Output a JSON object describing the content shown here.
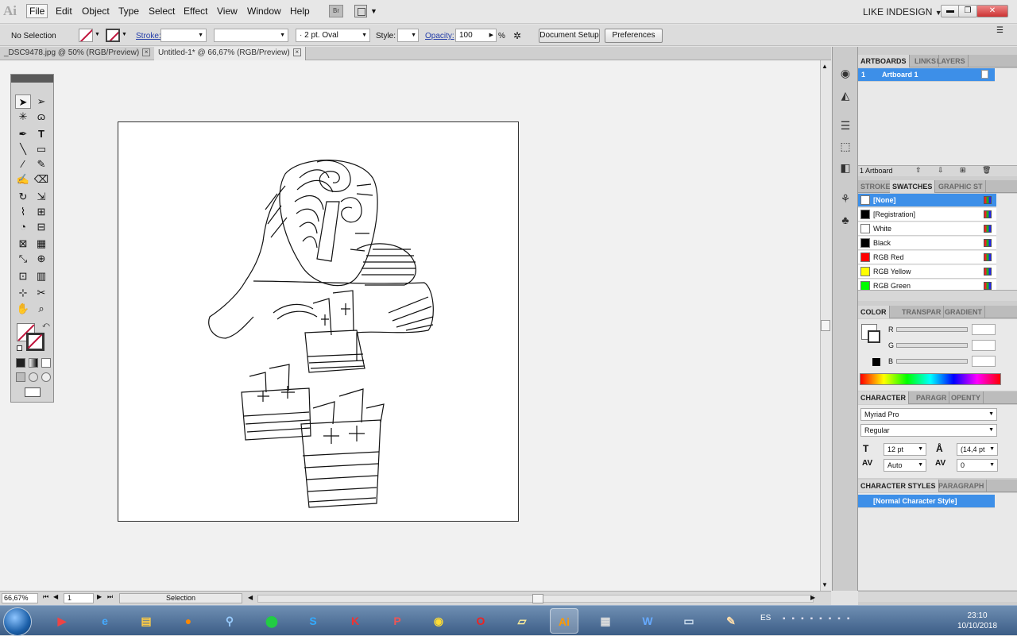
{
  "app": {
    "logo": "Ai",
    "workspace": "LIKE INDESIGN",
    "bridge_label": "Br"
  },
  "menu": [
    "File",
    "Edit",
    "Object",
    "Type",
    "Select",
    "Effect",
    "View",
    "Window",
    "Help"
  ],
  "control": {
    "selection": "No Selection",
    "stroke_label": "Stroke:",
    "brush": "2 pt. Oval",
    "style_label": "Style:",
    "opacity_label": "Opacity:",
    "opacity_value": "100",
    "opacity_unit": "%",
    "document_setup": "Document Setup",
    "preferences": "Preferences"
  },
  "tabs": [
    {
      "label": "_DSC9478.jpg @ 50% (RGB/Preview)"
    },
    {
      "label": "Untitled-1* @ 66,67% (RGB/Preview)"
    }
  ],
  "status": {
    "zoom": "66,67%",
    "artboard": "1",
    "mode": "Selection"
  },
  "panels": {
    "artboards": {
      "tabs": [
        "ARTBOARDS",
        "LINKS",
        "LAYERS"
      ],
      "items": [
        {
          "num": "1",
          "name": "Artboard 1"
        }
      ],
      "footer": "1 Artboard"
    },
    "swatches": {
      "tabs": [
        "STROKE",
        "SWATCHES",
        "GRAPHIC ST"
      ],
      "items": [
        {
          "name": "[None]",
          "color": "#ffffff"
        },
        {
          "name": "[Registration]",
          "color": "#000000"
        },
        {
          "name": "White",
          "color": "#ffffff"
        },
        {
          "name": "Black",
          "color": "#000000"
        },
        {
          "name": "RGB Red",
          "color": "#ff0000"
        },
        {
          "name": "RGB Yellow",
          "color": "#ffff00"
        },
        {
          "name": "RGB Green",
          "color": "#00ff00"
        }
      ]
    },
    "color": {
      "tabs": [
        "COLOR",
        "TRANSPAR",
        "GRADIENT"
      ],
      "channels": [
        "R",
        "G",
        "B"
      ]
    },
    "character": {
      "tabs": [
        "CHARACTER",
        "PARAGR",
        "OPENTY"
      ],
      "font": "Myriad Pro",
      "style": "Regular",
      "size": "12 pt",
      "leading": "(14,4 pt",
      "kerning": "Auto",
      "tracking": "0"
    },
    "char_styles": {
      "tabs": [
        "CHARACTER STYLES",
        "PARAGRAPH"
      ],
      "items": [
        "[Normal Character Style]"
      ]
    }
  },
  "taskbar": {
    "lang": "ES",
    "time": "23:10",
    "date": "10/10/2018"
  }
}
